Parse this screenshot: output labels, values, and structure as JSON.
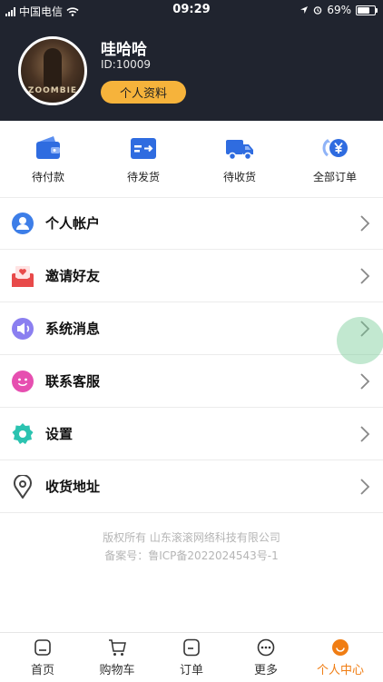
{
  "status_bar": {
    "carrier": "中国电信",
    "time": "09:29",
    "battery": "69%"
  },
  "profile": {
    "avatar_text": "ZOOMBIE",
    "name": "哇哈哈",
    "user_id": "ID:10009",
    "profile_button": "个人资料"
  },
  "orders": [
    {
      "label": "待付款",
      "icon": "wallet-icon"
    },
    {
      "label": "待发货",
      "icon": "card-arrow-icon"
    },
    {
      "label": "待收货",
      "icon": "truck-icon"
    },
    {
      "label": "全部订单",
      "icon": "yen-cycle-icon"
    }
  ],
  "menu": [
    {
      "label": "个人帐户",
      "icon": "user-circle-icon"
    },
    {
      "label": "邀请好友",
      "icon": "heart-envelope-icon"
    },
    {
      "label": "系统消息",
      "icon": "speaker-icon"
    },
    {
      "label": "联系客服",
      "icon": "smile-chat-icon"
    },
    {
      "label": "设置",
      "icon": "gear-icon"
    },
    {
      "label": "收货地址",
      "icon": "location-pin-icon"
    }
  ],
  "footer": {
    "copyright": "版权所有 山东滚滚网络科技有限公司",
    "icp": "备案号：鲁ICP备2022024543号-1"
  },
  "tabbar": [
    {
      "label": "首页",
      "icon": "home-icon"
    },
    {
      "label": "购物车",
      "icon": "cart-icon"
    },
    {
      "label": "订单",
      "icon": "order-doc-icon"
    },
    {
      "label": "更多",
      "icon": "more-icon"
    },
    {
      "label": "个人中心",
      "icon": "smile-user-icon"
    }
  ],
  "colors": {
    "header_bg": "#20242f",
    "accent": "#f6b33b",
    "active_tab": "#f07d13",
    "order_icon_blue": "#2f6ce0"
  }
}
